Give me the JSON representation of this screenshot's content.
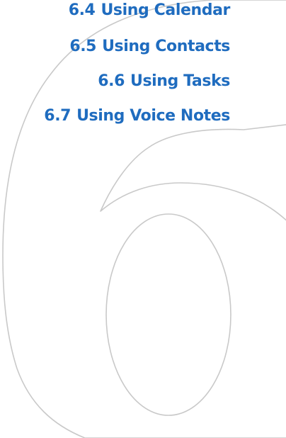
{
  "chapter": {
    "number": "6",
    "outline_color": "#c9c9c9"
  },
  "toc": {
    "color": "#1f6cbf",
    "items": [
      {
        "number": "6.4",
        "title": "Using Calendar"
      },
      {
        "number": "6.5",
        "title": "Using Contacts"
      },
      {
        "number": "6.6",
        "title": "Using Tasks"
      },
      {
        "number": "6.7",
        "title": "Using Voice Notes"
      }
    ]
  }
}
